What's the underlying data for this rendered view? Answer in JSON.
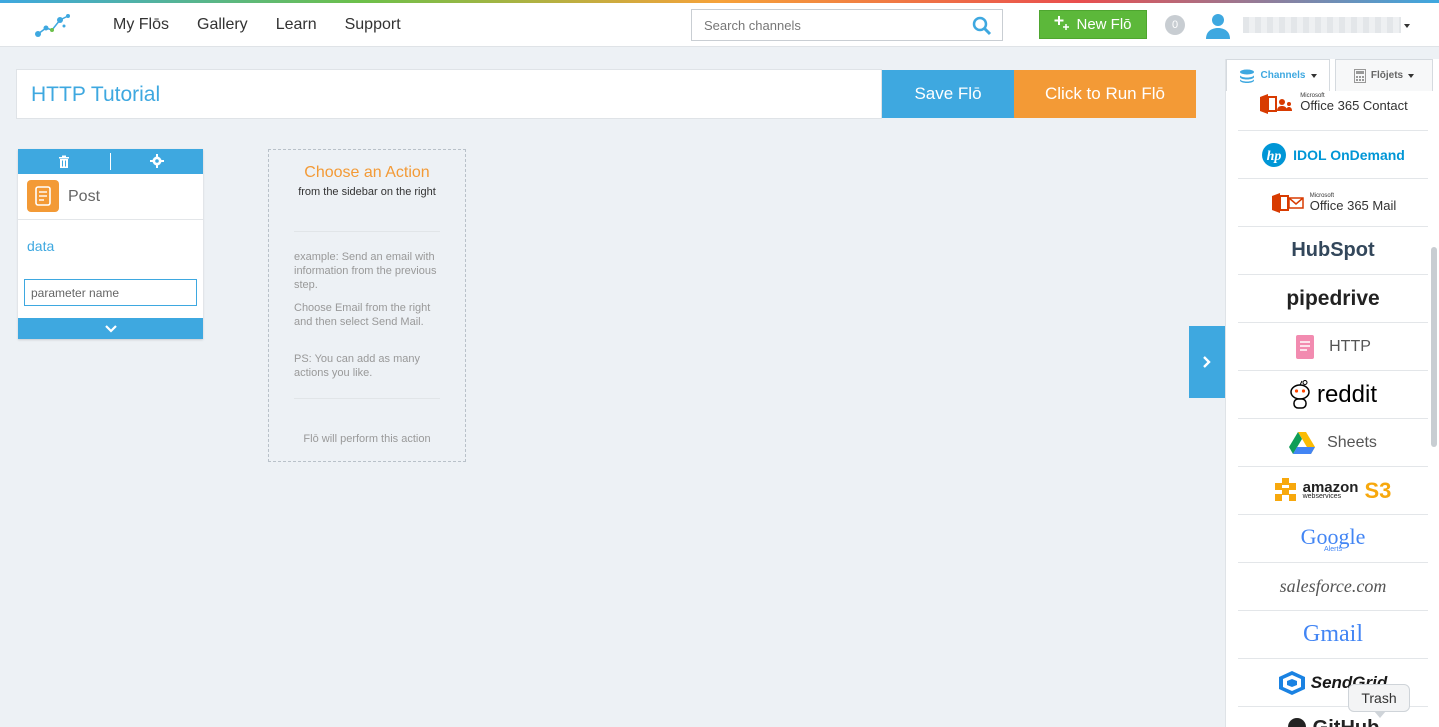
{
  "header": {
    "nav": [
      "My Flōs",
      "Gallery",
      "Learn",
      "Support"
    ],
    "search_placeholder": "Search channels",
    "new_flo_label": "New Flō",
    "notification_count": "0"
  },
  "flow": {
    "title": "HTTP Tutorial",
    "save_label": "Save Flō",
    "run_label": "Click to Run Flō"
  },
  "trigger": {
    "name": "Post",
    "field_label": "data",
    "param_placeholder": "parameter name"
  },
  "action_placeholder": {
    "title": "Choose an Action",
    "subtitle": "from the sidebar on the right",
    "tip1": "example: Send an email with information from the previous step.",
    "tip2": "Choose Email from the right and then select Send Mail.",
    "tip3": "PS: You can add as many actions you like.",
    "footer": "Flō will perform this action"
  },
  "sidebar": {
    "tab_channels": "Channels",
    "tab_flojets": "Flōjets",
    "channels": [
      {
        "brand": "Microsoft",
        "name": "Office 365 Contact"
      },
      {
        "name": "IDOL OnDemand"
      },
      {
        "brand": "Microsoft",
        "name": "Office 365 Mail"
      },
      {
        "name": "HubSpot"
      },
      {
        "name": "pipedrive"
      },
      {
        "name": "HTTP"
      },
      {
        "name": "reddit"
      },
      {
        "name": "Sheets"
      },
      {
        "name": "amazon",
        "sub": "webservices",
        "suffix": "S3"
      },
      {
        "name": "Google",
        "sub": "Alerts"
      },
      {
        "name": "salesforce.com"
      },
      {
        "name": "Gmail"
      },
      {
        "name": "SendGrid"
      },
      {
        "name": "GitHub"
      }
    ]
  },
  "tooltip": "Trash",
  "colors": {
    "accent_blue": "#3ea8e0",
    "accent_orange": "#f39a36",
    "accent_green": "#5cb83a"
  }
}
